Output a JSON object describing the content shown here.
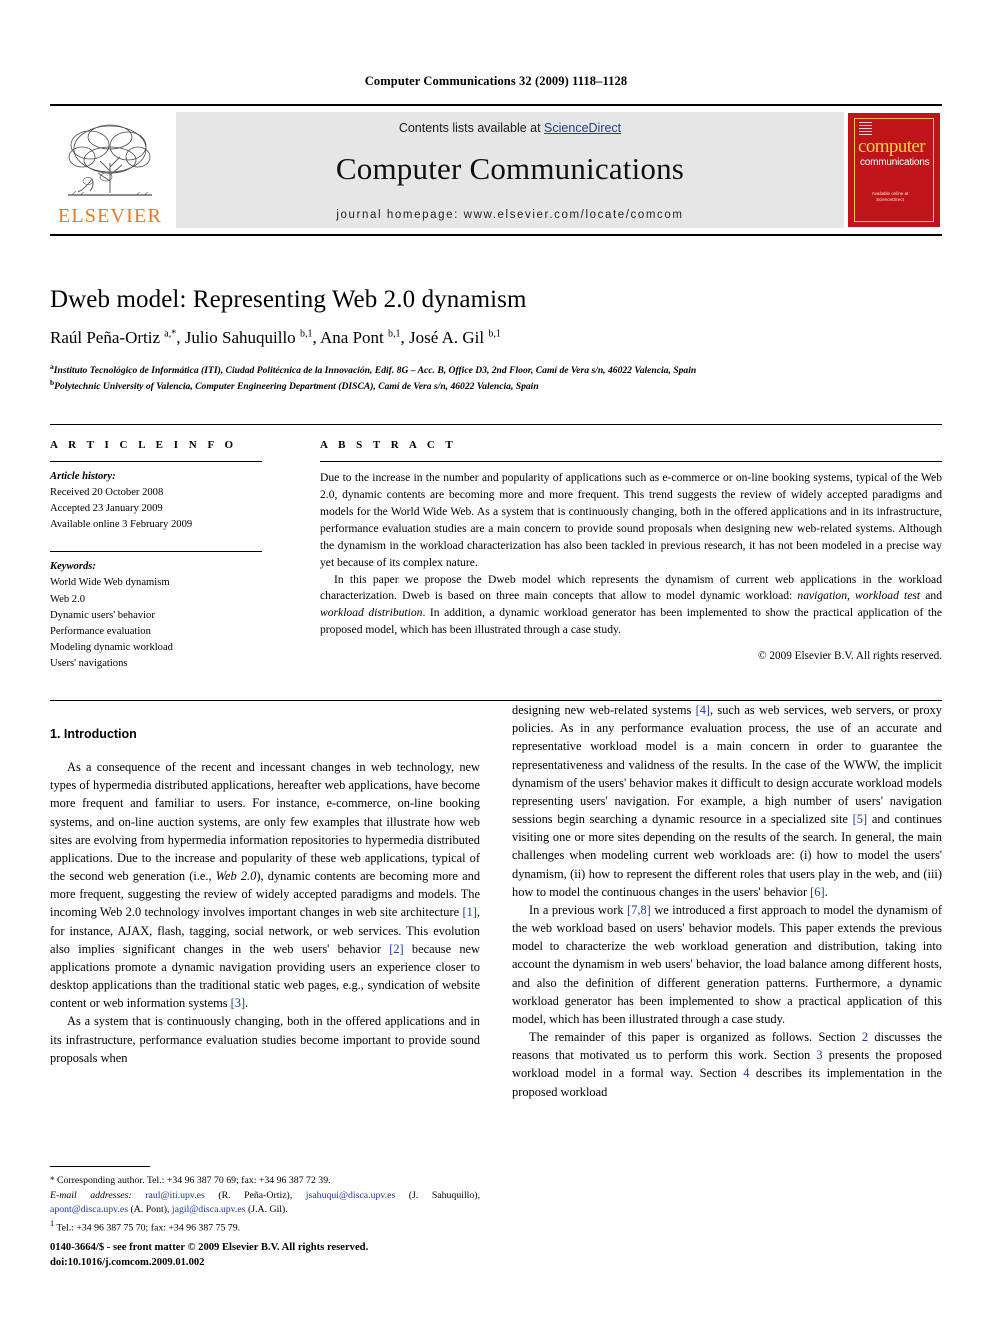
{
  "running_head": "Computer Communications 32 (2009) 1118–1128",
  "masthead": {
    "publisher_name": "ELSEVIER",
    "contents_prefix": "Contents lists available at ",
    "sciencedirect": "ScienceDirect",
    "journal_title": "Computer Communications",
    "homepage": "journal homepage: www.elsevier.com/locate/comcom",
    "cover": {
      "line1": "computer",
      "line2": "communications",
      "sd_note": "Available online at ScienceDirect"
    },
    "accent_color": "#E87722",
    "cover_color": "#c0141b",
    "link_color": "#2a3b8f"
  },
  "article": {
    "title": "Dweb model: Representing Web 2.0 dynamism",
    "authors_html": "Raúl Peña-Ortiz <sup>a,</sup><sup>*</sup>, Julio Sahuquillo <sup>b,1</sup>, Ana Pont <sup>b,1</sup>, José A. Gil <sup>b,1</sup>",
    "affiliation_a": "Instituto Tecnológico de Informática (ITI), Ciudad Politécnica de la Innovación, Edif. 8G – Acc. B, Office D3, 2nd Floor, Camí de Vera s/n, 46022 Valencia, Spain",
    "affiliation_b": "Polytechnic University of Valencia, Computer Engineering Department (DISCA), Camí de Vera s/n, 46022 Valencia, Spain"
  },
  "article_info": {
    "heading": "A R T I C L E  I N F O",
    "history_label": "Article history:",
    "history": [
      "Received 20 October 2008",
      "Accepted 23 January 2009",
      "Available online 3 February 2009"
    ],
    "keywords_label": "Keywords:",
    "keywords": [
      "World Wide Web dynamism",
      "Web 2.0",
      "Dynamic users' behavior",
      "Performance evaluation",
      "Modeling dynamic workload",
      "Users' navigations"
    ]
  },
  "abstract": {
    "heading": "A B S T R A C T",
    "paragraph1": "Due to the increase in the number and popularity of applications such as e-commerce or on-line booking systems, typical of the Web 2.0, dynamic contents are becoming more and more frequent. This trend suggests the review of widely accepted paradigms and models for the World Wide Web. As a system that is continuously changing, both in the offered applications and in its infrastructure, performance evaluation studies are a main concern to provide sound proposals when designing new web-related systems. Although the dynamism in the workload characterization has also been tackled in previous research, it has not been modeled in a precise way yet because of its complex nature.",
    "paragraph2_a": "In this paper we propose the Dweb model which represents the dynamism of current web applications in the workload characterization. Dweb is based on three main concepts that allow to model dynamic workload: ",
    "paragraph2_italic1": "navigation, workload test",
    "paragraph2_b": " and ",
    "paragraph2_italic2": "workload distribution",
    "paragraph2_c": ". In addition, a dynamic workload generator has been implemented to show the practical application of the proposed model, which has been illustrated through a case study.",
    "copyright": "© 2009 Elsevier B.V. All rights reserved."
  },
  "body": {
    "section1_title": "1. Introduction",
    "left_p1": "As a consequence of the recent and incessant changes in web technology, new types of hypermedia distributed applications, hereafter web applications, have become more frequent and familiar to users. For instance, e-commerce, on-line booking systems, and on-line auction systems, are only few examples that illustrate how web sites are evolving from hypermedia information repositories to hypermedia distributed applications. Due to the increase and popularity of these web applications, typical of the second web generation (i.e., ",
    "left_p1_italic": "Web 2.0",
    "left_p1_b": "), dynamic contents are becoming more and more frequent, suggesting the review of widely accepted paradigms and models. The incoming Web 2.0 technology involves important changes in web site architecture ",
    "left_p1_ref1": "[1]",
    "left_p1_c": ", for instance, AJAX, flash, tagging, social network, or web services. This evolution also implies significant changes in the web users' behavior ",
    "left_p1_ref2": "[2]",
    "left_p1_d": " because new applications promote a dynamic navigation providing users an experience closer to desktop applications than the traditional static web pages, e.g., syndication of website content or web information systems ",
    "left_p1_ref3": "[3]",
    "left_p1_e": ".",
    "left_p2": "As a system that is continuously changing, both in the offered applications and in its infrastructure, performance evaluation studies become important to provide sound proposals when",
    "right_p1_a": "designing new web-related systems ",
    "right_p1_ref4": "[4]",
    "right_p1_b": ", such as web services, web servers, or proxy policies. As in any performance evaluation process, the use of an accurate and representative workload model is a main concern in order to guarantee the representativeness and validness of the results. In the case of the WWW, the implicit dynamism of the users' behavior makes it difficult to design accurate workload models representing users' navigation. For example, a high number of users' navigation sessions begin searching a dynamic resource in a specialized site ",
    "right_p1_ref5": "[5]",
    "right_p1_c": " and continues visiting one or more sites depending on the results of the search. In general, the main challenges when modeling current web workloads are: (i) how to model the users' dynamism, (ii) how to represent the different roles that users play in the web, and (iii) how to model the continuous changes in the users' behavior ",
    "right_p1_ref6": "[6]",
    "right_p1_d": ".",
    "right_p2_a": "In a previous work ",
    "right_p2_ref": "[7,8]",
    "right_p2_b": " we introduced a first approach to model the dynamism of the web workload based on users' behavior models. This paper extends the previous model to characterize the web workload generation and distribution, taking into account the dynamism in web users' behavior, the load balance among different hosts, and also the definition of different generation patterns. Furthermore, a dynamic workload generator has been implemented to show a practical application of this model, which has been illustrated through a case study.",
    "right_p3_a": "The remainder of this paper is organized as follows. Section ",
    "right_p3_ref2": "2",
    "right_p3_b": " discusses the reasons that motivated us to perform this work. Section ",
    "right_p3_ref3": "3",
    "right_p3_c": " presents the proposed workload model in a formal way. Section ",
    "right_p3_ref4": "4",
    "right_p3_d": " describes its implementation in the proposed workload"
  },
  "footnotes": {
    "corresponding_marker": "*",
    "corresponding": " Corresponding author. Tel.: +34 96 387 70 69; fax: +34 96 387 72 39.",
    "email_label": "E-mail addresses:",
    "emails": [
      {
        "address": "raul@iti.upv.es",
        "owner": " (R. Peña-Ortiz)"
      },
      {
        "address": "jsahuqui@disca.upv.es",
        "owner": " (J. Sahuquillo)"
      },
      {
        "address": "apont@disca.upv.es",
        "owner": " (A. Pont)"
      },
      {
        "address": "jagil@disca.upv.es",
        "owner": " (J.A. Gil)"
      }
    ],
    "note1_marker": "1",
    "note1": " Tel.: +34 96 387 75 70; fax: +34 96 387 75 79."
  },
  "footer": {
    "issn_line": "0140-3664/$ - see front matter © 2009 Elsevier B.V. All rights reserved.",
    "doi_line": "doi:10.1016/j.comcom.2009.01.002"
  }
}
